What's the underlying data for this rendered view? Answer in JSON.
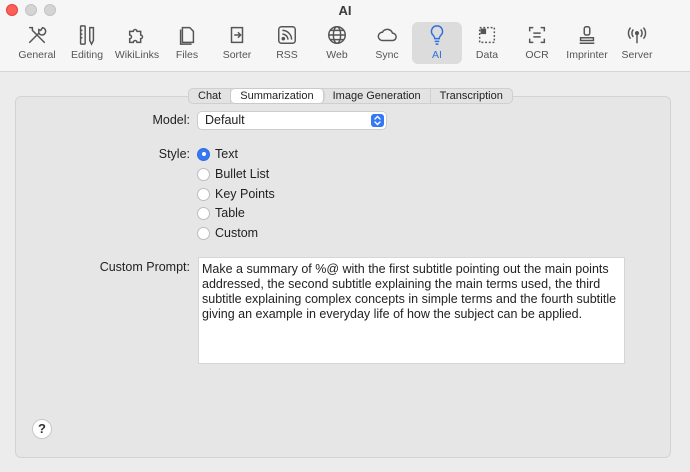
{
  "window": {
    "title": "AI"
  },
  "toolbar": {
    "items": [
      {
        "label": "General",
        "icon": "tools-icon"
      },
      {
        "label": "Editing",
        "icon": "pencil-ruler-icon"
      },
      {
        "label": "WikiLinks",
        "icon": "puzzle-icon"
      },
      {
        "label": "Files",
        "icon": "files-icon"
      },
      {
        "label": "Sorter",
        "icon": "sorter-icon"
      },
      {
        "label": "RSS",
        "icon": "rss-icon"
      },
      {
        "label": "Web",
        "icon": "globe-icon"
      },
      {
        "label": "Sync",
        "icon": "cloud-icon"
      },
      {
        "label": "AI",
        "icon": "lightbulb-icon"
      },
      {
        "label": "Data",
        "icon": "data-icon"
      },
      {
        "label": "OCR",
        "icon": "ocr-icon"
      },
      {
        "label": "Imprinter",
        "icon": "stamp-icon"
      },
      {
        "label": "Server",
        "icon": "antenna-icon"
      }
    ],
    "active": "AI",
    "accent": "#2f6fde"
  },
  "tabs": [
    "Chat",
    "Summarization",
    "Image Generation",
    "Transcription"
  ],
  "active_tab": "Summarization",
  "model": {
    "label": "Model:",
    "value": "Default"
  },
  "style": {
    "label": "Style:",
    "options": [
      "Text",
      "Bullet List",
      "Key Points",
      "Table",
      "Custom"
    ],
    "selected": "Text"
  },
  "custom_prompt": {
    "label": "Custom Prompt:",
    "value": "Make a summary of %@ with the first subtitle pointing out the main points addressed, the second subtitle explaining the main terms used, the third subtitle explaining complex concepts in simple terms and the fourth subtitle giving an example in everyday life of how the subject can be applied."
  },
  "help": {
    "label": "?"
  }
}
